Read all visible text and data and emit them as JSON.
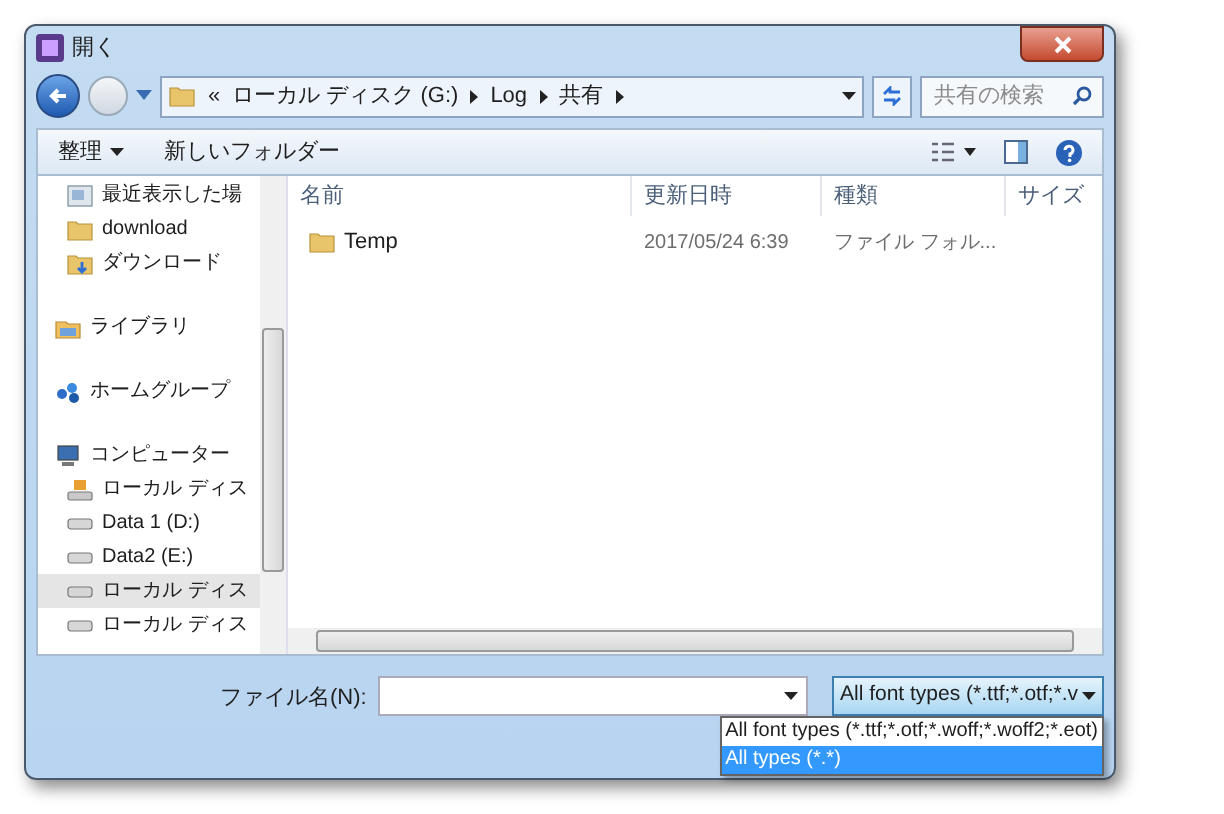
{
  "window": {
    "title": "開く"
  },
  "address": {
    "crumbs": [
      "«",
      "ローカル ディスク (G:)",
      "Log",
      "共有"
    ]
  },
  "search": {
    "placeholder": "共有の検索"
  },
  "toolbar": {
    "organize": "整理",
    "new_folder": "新しいフォルダー"
  },
  "sidebar": {
    "items": [
      {
        "children": [
          {
            "label": "最近表示した場",
            "kind": "recent",
            "selected": false
          },
          {
            "label": "download",
            "kind": "folder",
            "selected": false
          },
          {
            "label": "ダウンロード",
            "kind": "download",
            "selected": false
          }
        ]
      },
      {
        "label": "ライブラリ",
        "kind": "library",
        "selected": false
      },
      {
        "label": "ホームグループ",
        "kind": "homegroup",
        "selected": false
      },
      {
        "label": "コンピューター",
        "kind": "computer",
        "selected": false,
        "children": [
          {
            "label": "ローカル ディス",
            "kind": "system-drive",
            "selected": false
          },
          {
            "label": "Data 1 (D:)",
            "kind": "drive",
            "selected": false
          },
          {
            "label": "Data2 (E:)",
            "kind": "drive",
            "selected": false
          },
          {
            "label": "ローカル ディス",
            "kind": "drive",
            "selected": true
          },
          {
            "label": "ローカル ディス",
            "kind": "drive",
            "selected": false
          }
        ]
      }
    ]
  },
  "table": {
    "columns": [
      "名前",
      "更新日時",
      "種類",
      "サイズ"
    ],
    "rows": [
      {
        "name": "Temp",
        "modified": "2017/05/24 6:39",
        "type": "ファイル フォル..."
      }
    ]
  },
  "filename": {
    "label": "ファイル名(N):"
  },
  "filetype": {
    "value": "All font types (*.ttf;*.otf;*.v",
    "expanded": true,
    "options": [
      {
        "label": "All font types (*.ttf;*.otf;*.woff;*.woff2;*.eot)",
        "selected": false
      },
      {
        "label": "All types (*.*)",
        "selected": true
      }
    ]
  }
}
